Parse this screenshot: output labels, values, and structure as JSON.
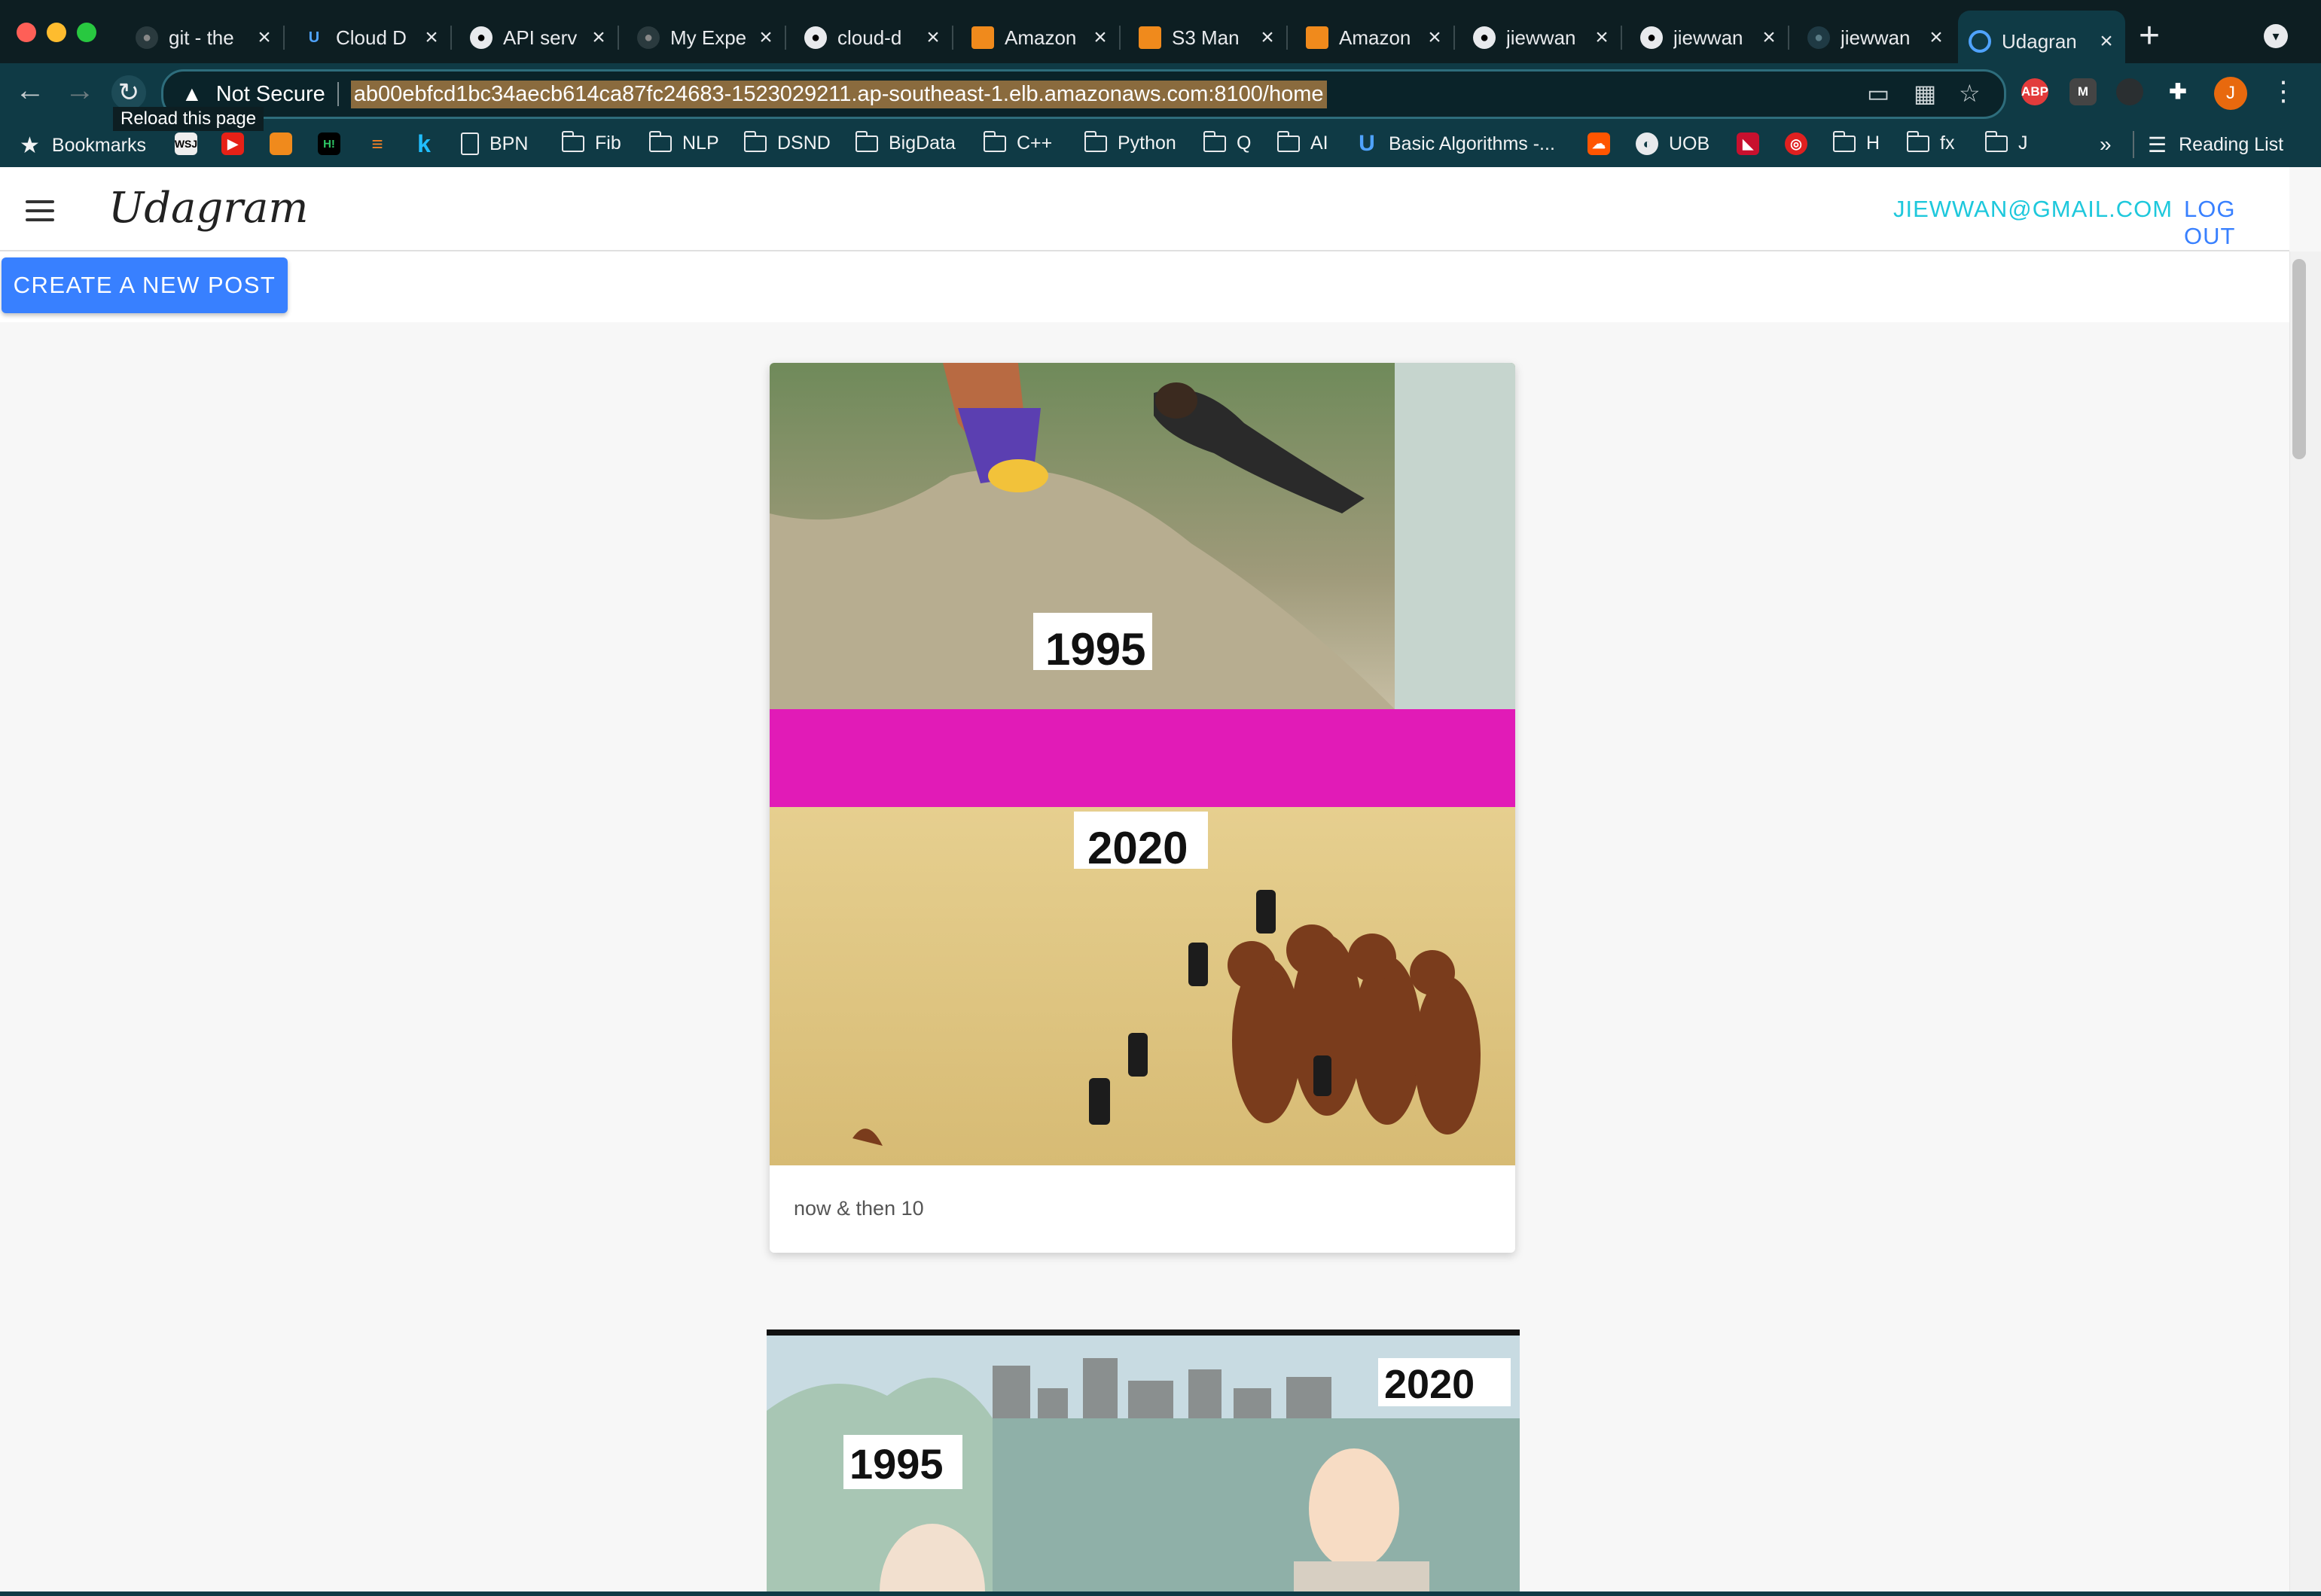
{
  "browser": {
    "tabs": [
      {
        "title": "git - the",
        "icon": "github-icon"
      },
      {
        "title": "Cloud D",
        "icon": "udacity-icon"
      },
      {
        "title": "API serv",
        "icon": "api-icon"
      },
      {
        "title": "My Expe",
        "icon": "globe-icon"
      },
      {
        "title": "cloud-d",
        "icon": "github-icon"
      },
      {
        "title": "Amazon",
        "icon": "aws-icon"
      },
      {
        "title": "S3 Man",
        "icon": "aws-icon"
      },
      {
        "title": "Amazon",
        "icon": "aws-icon"
      },
      {
        "title": "jiewwan",
        "icon": "github-icon"
      },
      {
        "title": "jiewwan",
        "icon": "github-icon"
      },
      {
        "title": "jiewwan",
        "icon": "globe-icon"
      },
      {
        "title": "Udagran",
        "icon": "chrome-icon",
        "active": true
      }
    ],
    "security_label": "Not Secure",
    "url": "ab00ebfcd1bc34aecb614ca87fc24683-1523029211.ap-southeast-1.elb.amazonaws.com:8100/home",
    "tooltip": "Reload this page",
    "profile_initial": "J",
    "extension_abp": "ABP",
    "extension_m": "M",
    "bookmarks": [
      {
        "label": "Bookmarks",
        "icon": "star-icon"
      },
      {
        "label": "",
        "icon": "wsj-icon"
      },
      {
        "label": "",
        "icon": "youtube-icon"
      },
      {
        "label": "",
        "icon": "aws-icon"
      },
      {
        "label": "",
        "icon": "hackerrank-icon"
      },
      {
        "label": "",
        "icon": "stack-icon"
      },
      {
        "label": "",
        "icon": "k-icon"
      },
      {
        "label": "BPN",
        "icon": "page-icon"
      },
      {
        "label": "Fib",
        "icon": "folder-icon"
      },
      {
        "label": "NLP",
        "icon": "folder-icon"
      },
      {
        "label": "DSND",
        "icon": "folder-icon"
      },
      {
        "label": "BigData",
        "icon": "folder-icon"
      },
      {
        "label": "C++",
        "icon": "folder-icon"
      },
      {
        "label": "Python",
        "icon": "folder-icon"
      },
      {
        "label": "Q",
        "icon": "folder-icon"
      },
      {
        "label": "AI",
        "icon": "folder-icon"
      },
      {
        "label": "Basic Algorithms -...",
        "icon": "udacity-icon"
      },
      {
        "label": "",
        "icon": "soundcloud-icon"
      },
      {
        "label": "UOB",
        "icon": "globe-icon"
      },
      {
        "label": "",
        "icon": "flag-icon"
      },
      {
        "label": "",
        "icon": "red-circle-icon"
      },
      {
        "label": "H",
        "icon": "folder-icon"
      },
      {
        "label": "fx",
        "icon": "folder-icon"
      },
      {
        "label": "J",
        "icon": "folder-icon"
      }
    ],
    "overflow_label": "»",
    "reading_list": "Reading List"
  },
  "app": {
    "brand": "Udagram",
    "user_email": "JIEWWAN@GMAIL.COM",
    "logout_label": "LOG OUT",
    "create_label": "CREATE A NEW POST",
    "posts": [
      {
        "caption": "now & then 10",
        "image_labels": [
          "1995",
          "2020"
        ]
      },
      {
        "caption": "",
        "image_labels": [
          "1995",
          "2020"
        ]
      }
    ]
  },
  "colors": {
    "chrome_bg": "#0d1e22",
    "toolbar_bg": "#0f3a45",
    "accent": "#3880ff",
    "email": "#1ec8dc"
  }
}
